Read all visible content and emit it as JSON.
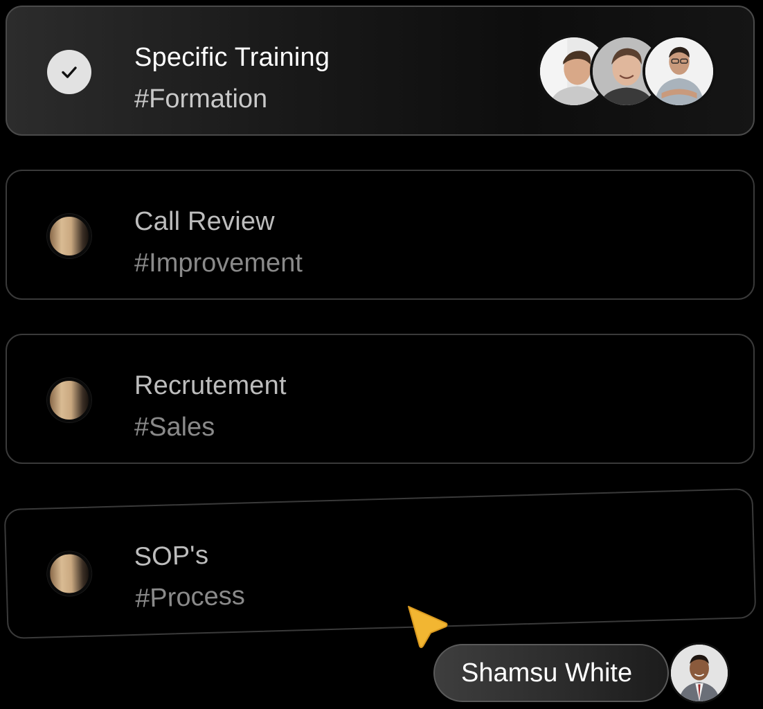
{
  "tasks": [
    {
      "title": "Specific Training",
      "tag": "#Formation",
      "status": "done"
    },
    {
      "title": "Call Review",
      "tag": "#Improvement",
      "status": "pending"
    },
    {
      "title": "Recrutement",
      "tag": "#Sales",
      "status": "pending"
    },
    {
      "title": "SOP's",
      "tag": "#Process",
      "status": "pending"
    }
  ],
  "assignees": [
    {
      "icon": "avatar-icon"
    },
    {
      "icon": "avatar-icon"
    },
    {
      "icon": "avatar-icon"
    }
  ],
  "cursor": {
    "user_name": "Shamsu White",
    "color": "#f2b632",
    "icon": "pointer-icon"
  },
  "colors": {
    "background": "#000000",
    "card_border": "#3a3a3a",
    "check_circle": "#e2e2e2"
  }
}
